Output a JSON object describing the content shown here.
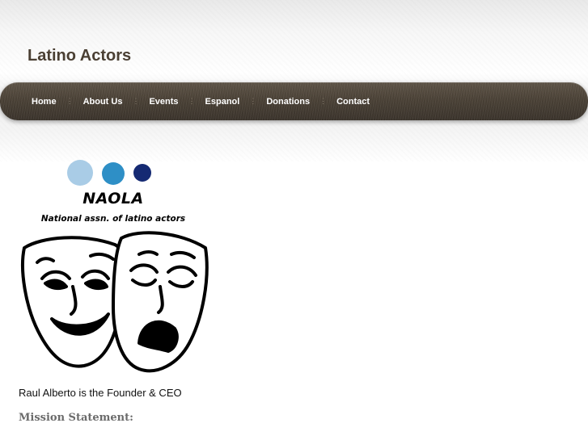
{
  "site": {
    "title": "Latino Actors"
  },
  "nav": {
    "items": [
      {
        "label": "Home"
      },
      {
        "label": "About Us"
      },
      {
        "label": "Events"
      },
      {
        "label": "Espanol"
      },
      {
        "label": "Donations"
      },
      {
        "label": "Contact"
      }
    ],
    "separator": "⋮"
  },
  "logo": {
    "name": "NAOLA",
    "tagline": "National assn. of latino actors",
    "dot_colors": [
      "#a9cce6",
      "#2e8fc6",
      "#152a73"
    ],
    "image": "comedy-tragedy-masks"
  },
  "content": {
    "founder_text": "Raul Alberto is the Founder & CEO",
    "mission_heading": "Mission Statement:"
  },
  "colors": {
    "nav_bar": "#4b4237",
    "title_text": "#4a3f33",
    "mission_heading": "#6b6b6b"
  }
}
